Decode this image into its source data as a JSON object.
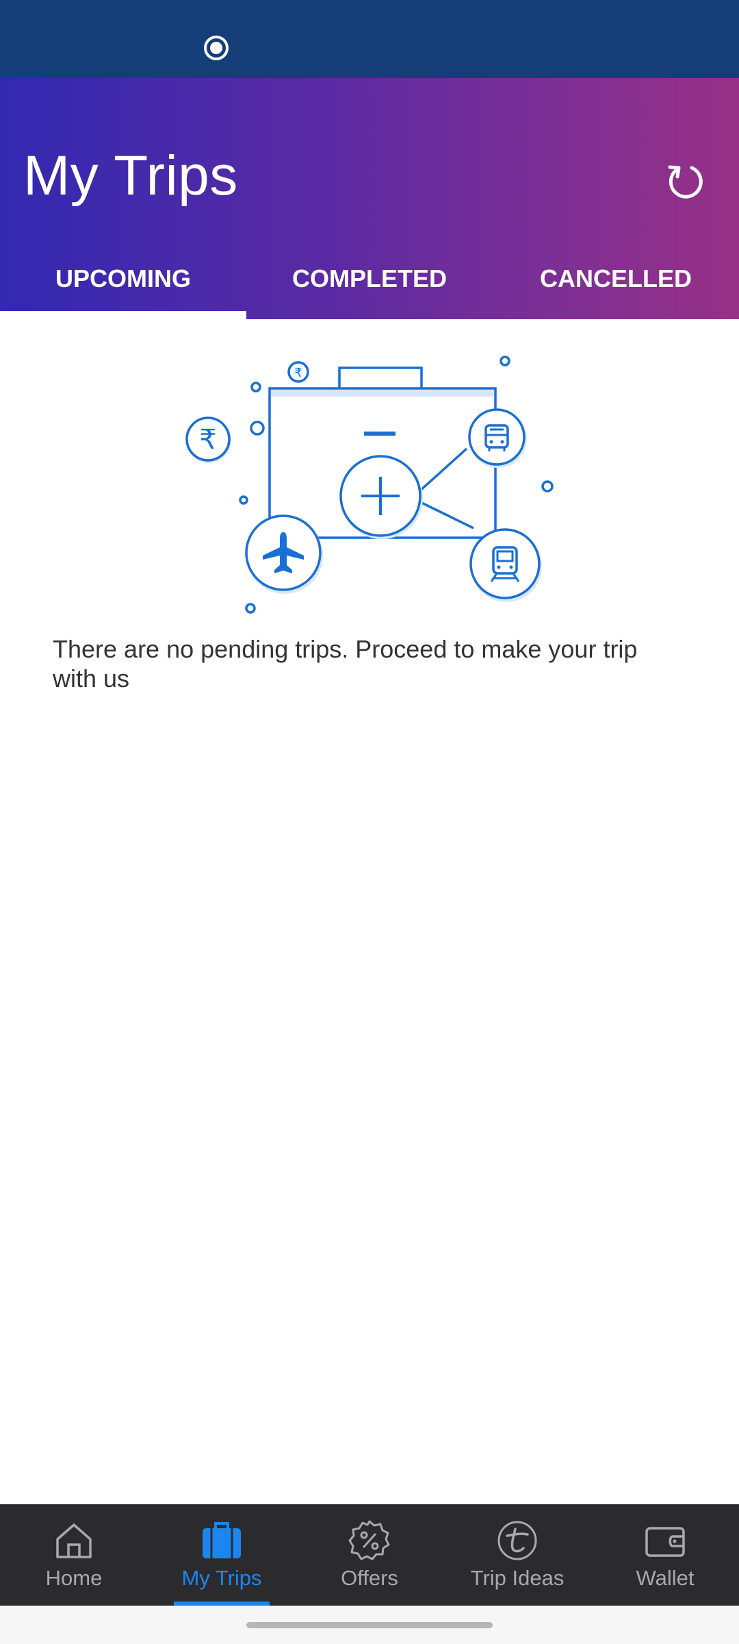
{
  "header": {
    "title": "My Trips",
    "refresh_icon": "refresh-icon",
    "gradient": [
      "#3229b1",
      "#973086"
    ]
  },
  "tabs": [
    {
      "label": "UPCOMING",
      "active": true
    },
    {
      "label": "COMPLETED",
      "active": false
    },
    {
      "label": "CANCELLED",
      "active": false
    }
  ],
  "empty_state": {
    "illustration_icon": "suitcase-travel-illustration",
    "message": "There are no pending trips. Proceed to make your trip with us"
  },
  "bottom_nav": {
    "items": [
      {
        "label": "Home",
        "icon": "home-icon",
        "active": false
      },
      {
        "label": "My Trips",
        "icon": "suitcase-icon",
        "active": true
      },
      {
        "label": "Offers",
        "icon": "offers-icon",
        "active": false
      },
      {
        "label": "Trip Ideas",
        "icon": "trip-ideas-icon",
        "active": false
      },
      {
        "label": "Wallet",
        "icon": "wallet-icon",
        "active": false
      }
    ]
  },
  "colors": {
    "accent": "#1c86ee",
    "status_bar": "#153e79",
    "nav_background": "#2b2b2e",
    "illustration": "#1a6fd4"
  }
}
